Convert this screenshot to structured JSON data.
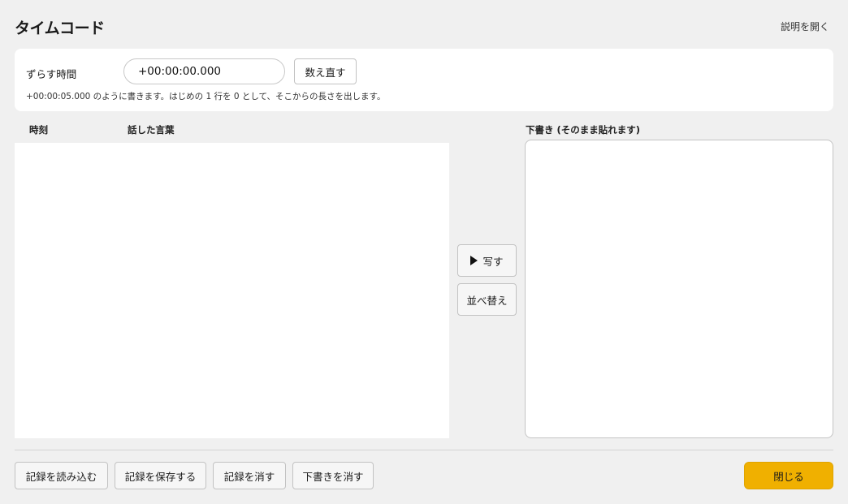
{
  "header": {
    "title": "タイムコード",
    "help_link": "説明を開く"
  },
  "offset": {
    "label": "ずらす時間",
    "value": "+00:00:00.000",
    "recount_button": "数え直す",
    "hint": "+00:00:05.000 のように書きます。はじめの 1 行を 0 として、そこからの長さを出します。"
  },
  "table": {
    "columns": [
      "時刻",
      "話した言葉"
    ],
    "rows": []
  },
  "actions": {
    "copy_button": "写す",
    "copy_icon": "play-icon",
    "sort_button": "並べ替え"
  },
  "draft": {
    "label": "下書き (そのまま貼れます)",
    "value": ""
  },
  "footer": {
    "load_button": "記録を読み込む",
    "save_button": "記録を保存する",
    "clear_button": "記録を消す",
    "clear_draft_button": "下書きを消す",
    "close_button": "閉じる",
    "accent_color": "#f0b000"
  }
}
